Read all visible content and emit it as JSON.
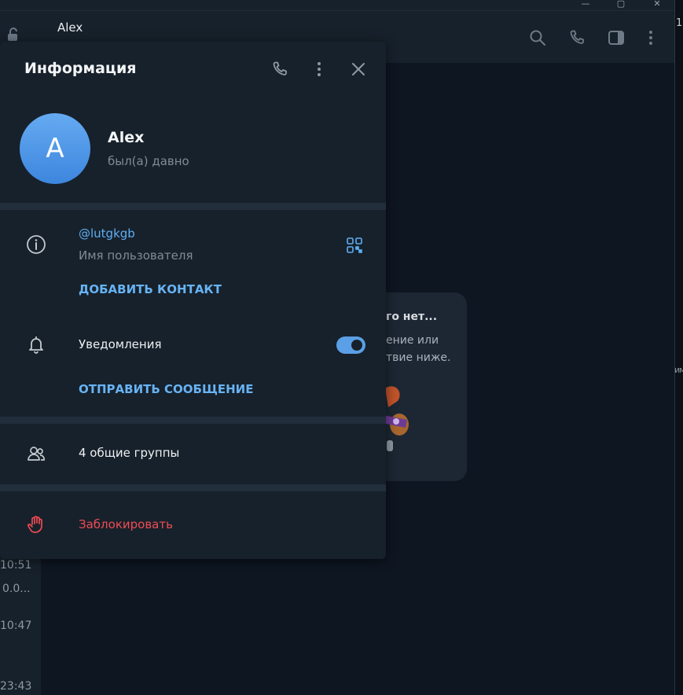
{
  "window": {
    "minimize_glyph": "—",
    "maximize_glyph": "▢",
    "close_glyph": "✕"
  },
  "chat_header": {
    "title": "Alex",
    "icons": [
      "lock-icon",
      "search-icon",
      "phone-icon",
      "sidebar-toggle-icon",
      "more-vertical-icon"
    ]
  },
  "sidebar_times": [
    "10:51",
    "0.0...",
    "10:47",
    "23:43"
  ],
  "right_edge": {
    "label_top": "1",
    "label_mid": "им"
  },
  "empty_chat": {
    "title_fragment": "го нет...",
    "line1": "ение или",
    "line2": "твие ниже."
  },
  "panel": {
    "title": "Информация",
    "header_icons": [
      "phone-icon",
      "more-vertical-icon",
      "close-icon"
    ],
    "profile": {
      "avatar_letter": "A",
      "name": "Alex",
      "status": "был(а) давно",
      "avatar_colors": [
        "#65aaf1",
        "#3d86de"
      ]
    },
    "info": {
      "username": "@lutgkgb",
      "username_label": "Имя пользователя",
      "add_contact": "ДОБАВИТЬ КОНТАКТ"
    },
    "notifications": {
      "label": "Уведомления",
      "enabled": true,
      "send_message": "ОТПРАВИТЬ СООБЩЕНИЕ"
    },
    "groups": {
      "label": "4 общие группы"
    },
    "block": {
      "label": "Заблокировать"
    }
  },
  "colors": {
    "background": "#0e1621",
    "panel": "#17212b",
    "accent": "#5eaff5",
    "danger": "#ef4b54",
    "divider": "#232e3c"
  }
}
